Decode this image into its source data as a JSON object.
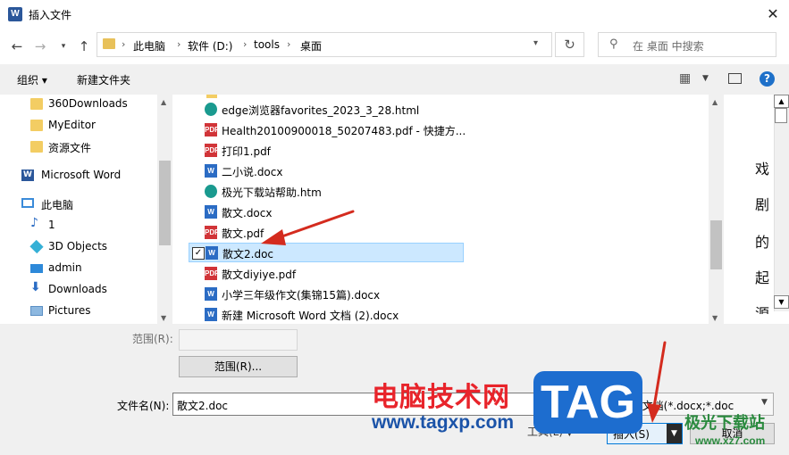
{
  "window": {
    "title": "插入文件",
    "app_icon": "word-icon",
    "close": "✕"
  },
  "address": {
    "crumbs": [
      "此电脑",
      "软件 (D:)",
      "tools",
      "桌面"
    ]
  },
  "search": {
    "placeholder": "在 桌面 中搜索"
  },
  "toolbar": {
    "organize": "组织 ▾",
    "new_folder": "新建文件夹",
    "help": "?"
  },
  "nav": {
    "items": [
      {
        "label": "360Downloads",
        "icon": "folder-icon"
      },
      {
        "label": "MyEditor",
        "icon": "folder-icon"
      },
      {
        "label": "资源文件",
        "icon": "folder-icon"
      },
      {
        "label": "Microsoft Word",
        "icon": "word-icon"
      },
      {
        "label": "此电脑",
        "icon": "computer-icon"
      },
      {
        "label": "1",
        "icon": "music-icon"
      },
      {
        "label": "3D Objects",
        "icon": "cube-icon"
      },
      {
        "label": "admin",
        "icon": "desktop-icon"
      },
      {
        "label": "Downloads",
        "icon": "download-icon"
      },
      {
        "label": "Pictures",
        "icon": "pictures-icon"
      }
    ]
  },
  "files": [
    {
      "name": "edge浏览器favorites_2023_3_28.html",
      "icon": "edge-icon"
    },
    {
      "name": "Health20100900018_50207483.pdf - 快捷方...",
      "icon": "pdf-shortcut-icon"
    },
    {
      "name": "打印1.pdf",
      "icon": "pdf-icon"
    },
    {
      "name": "二小说.docx",
      "icon": "docx-icon"
    },
    {
      "name": "极光下载站帮助.htm",
      "icon": "edge-icon"
    },
    {
      "name": "散文.docx",
      "icon": "docx-icon"
    },
    {
      "name": "散文.pdf",
      "icon": "pdf-icon"
    },
    {
      "name": "散文2.doc",
      "icon": "doc-icon",
      "selected": true
    },
    {
      "name": "散文diyiye.pdf",
      "icon": "pdf-icon"
    },
    {
      "name": "小学三年级作文(集锦15篇).docx",
      "icon": "docx-icon"
    },
    {
      "name": "新建 Microsoft Word 文档 (2).docx",
      "icon": "docx-icon"
    }
  ],
  "preview": {
    "chars": [
      "戏",
      "剧",
      "的",
      "起",
      "源"
    ]
  },
  "bottom": {
    "range_label": "范围(R):",
    "range_button": "范围(R)...",
    "filename_label": "文件名(N):",
    "filename_value": "散文2.doc",
    "filter_value": "Word 文档(*.docx;*.doc",
    "tools_label": "工具(L)",
    "insert_label": "插入(S)",
    "cancel_label": "取消"
  },
  "watermark": {
    "site_name": "电脑技术网",
    "site_url": "www.tagxp.com",
    "tag": "TAG",
    "site2_name": "极光下载站",
    "site2_url": "www.xz7.com"
  },
  "annotation_color": "#d42b1e"
}
